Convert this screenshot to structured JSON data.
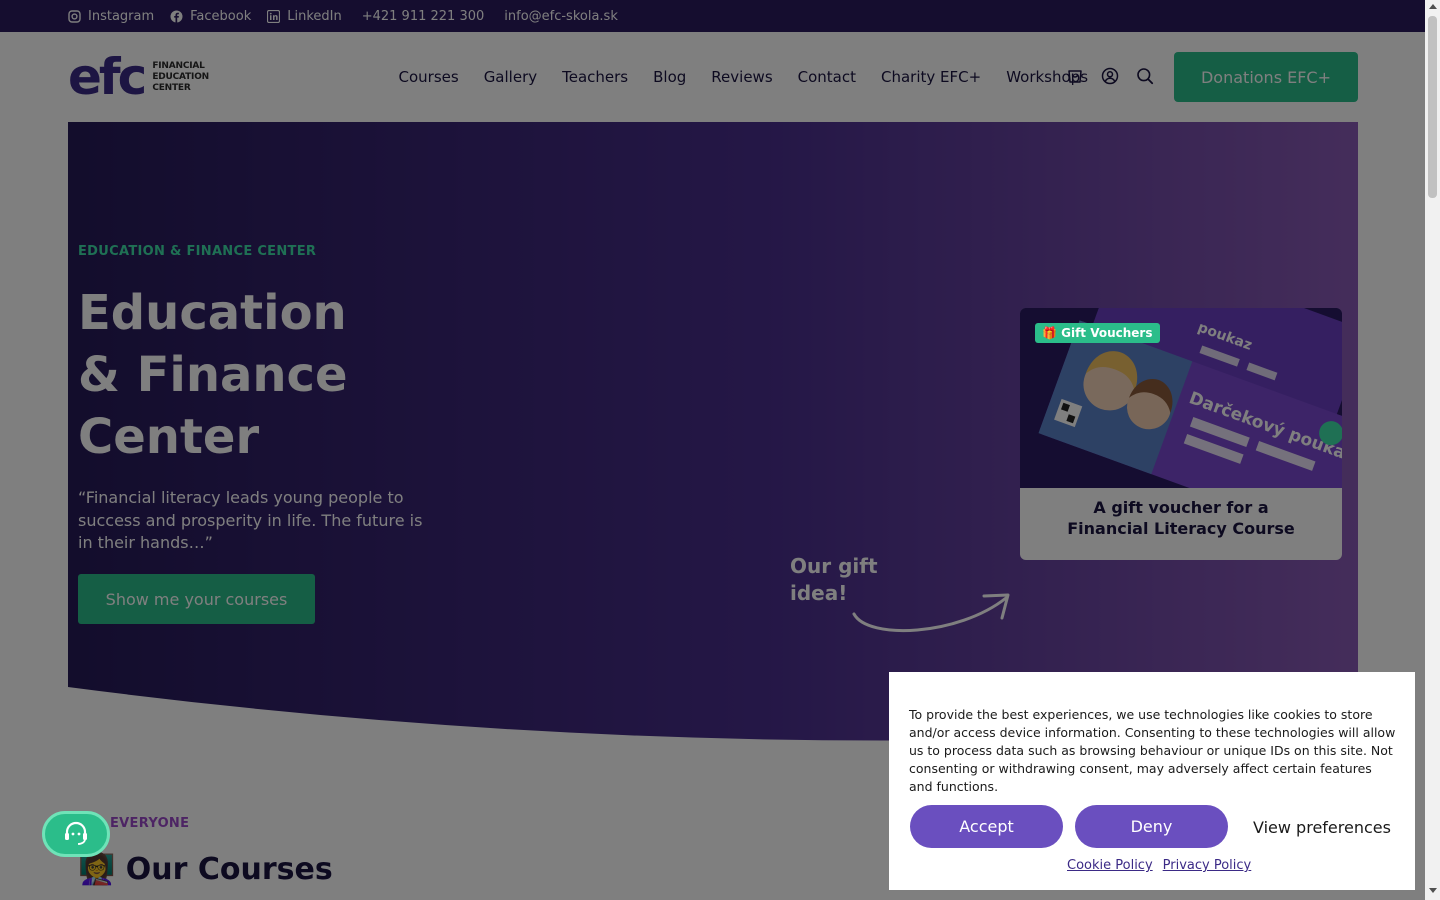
{
  "topbar": {
    "instagram": "Instagram",
    "facebook": "Facebook",
    "linkedin": "LinkedIn",
    "phone": "+421 911 221 300",
    "email": "info@efc-skola.sk"
  },
  "header": {
    "logo_mark": "efc",
    "logo_line1": "FINANCIAL",
    "logo_line2": "EDUCATION",
    "logo_line3": "CENTER",
    "nav": [
      "Courses",
      "Gallery",
      "Teachers",
      "Blog",
      "Reviews",
      "Contact",
      "Charity EFC+",
      "Workshops"
    ],
    "icons": [
      "cart-icon",
      "user-icon",
      "search-icon"
    ],
    "donate_label": "Donations EFC+"
  },
  "hero": {
    "eyebrow": "EDUCATION & FINANCE CENTER",
    "title_line1": "Education",
    "title_line2": "& Finance",
    "title_line3": "Center",
    "quote": "“Financial literacy leads young people to success and prosperity in life. The future is in their hands…”",
    "cta_label": "Show me your courses",
    "gift_note_line1": "Our gift",
    "gift_note_line2": "idea!",
    "gift_card": {
      "badge": "🎁 Gift Vouchers",
      "voucher_text": "Darčekový poukaz",
      "voucher_text_top": "poukaz",
      "title": "A gift voucher for a Financial Literacy Course"
    }
  },
  "courses": {
    "eyebrow": "EVERYONE",
    "title": "👩‍🏫 Our Courses"
  },
  "cookie": {
    "text": "To provide the best experiences, we use technologies like cookies to store and/or access device information. Consenting to these technologies will allow us to process data such as browsing behaviour or unique IDs on this site. Not consenting or withdrawing consent, may adversely affect certain features and functions.",
    "accept_label": "Accept",
    "deny_label": "Deny",
    "preferences_label": "View preferences",
    "cookie_policy_label": "Cookie Policy",
    "privacy_policy_label": "Privacy Policy"
  },
  "colors": {
    "topbar": "#2a1a5e",
    "brand_purple": "#3b2a86",
    "accent_green": "#2bbd8a",
    "button_purple": "#6a4fbf"
  }
}
